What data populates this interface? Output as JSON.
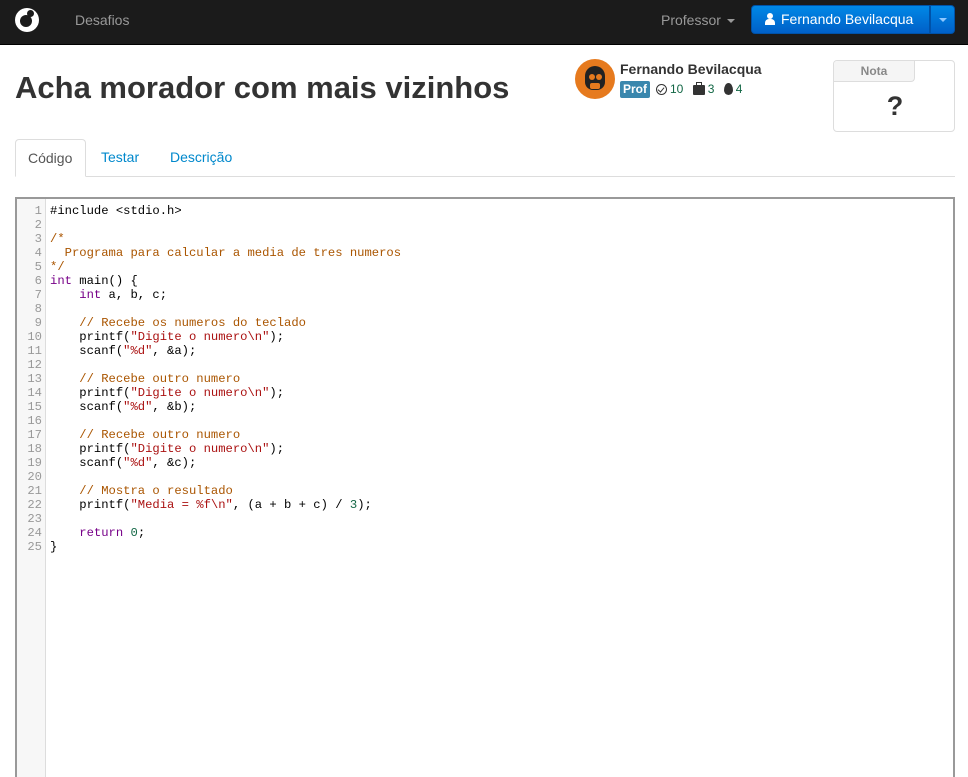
{
  "nav": {
    "brand": "logo",
    "link_desafios": "Desafios",
    "link_professor": "Professor",
    "user_button": "Fernando Bevilacqua"
  },
  "header": {
    "title": "Acha morador com mais vizinhos",
    "author": {
      "name": "Fernando Bevilacqua",
      "badge": "Prof",
      "stat_solved": "10",
      "stat_challenges": "3",
      "stat_streak": "4"
    },
    "nota": {
      "label": "Nota",
      "value": "?"
    }
  },
  "tabs": [
    {
      "label": "Código",
      "active": true
    },
    {
      "label": "Testar",
      "active": false
    },
    {
      "label": "Descrição",
      "active": false
    }
  ],
  "colors": {
    "navbar": "#1b1b1b",
    "primary_button": "#0074d9",
    "badge_info": "#3a87ad",
    "link": "#0088cc",
    "keyword": "#770088",
    "string": "#aa1111",
    "comment": "#aa5500"
  },
  "code": [
    "#include <stdio.h>",
    "",
    "/*",
    "  Programa para calcular a media de tres numeros",
    "*/",
    "int main() {",
    "    int a, b, c;",
    "",
    "    // Recebe os numeros do teclado",
    "    printf(\"Digite o numero\\n\");",
    "    scanf(\"%d\", &a);",
    "",
    "    // Recebe outro numero",
    "    printf(\"Digite o numero\\n\");",
    "    scanf(\"%d\", &b);",
    "",
    "    // Recebe outro numero",
    "    printf(\"Digite o numero\\n\");",
    "    scanf(\"%d\", &c);",
    "",
    "    // Mostra o resultado",
    "    printf(\"Media = %f\\n\", (a + b + c) / 3);",
    "",
    "    return 0;",
    "}"
  ]
}
